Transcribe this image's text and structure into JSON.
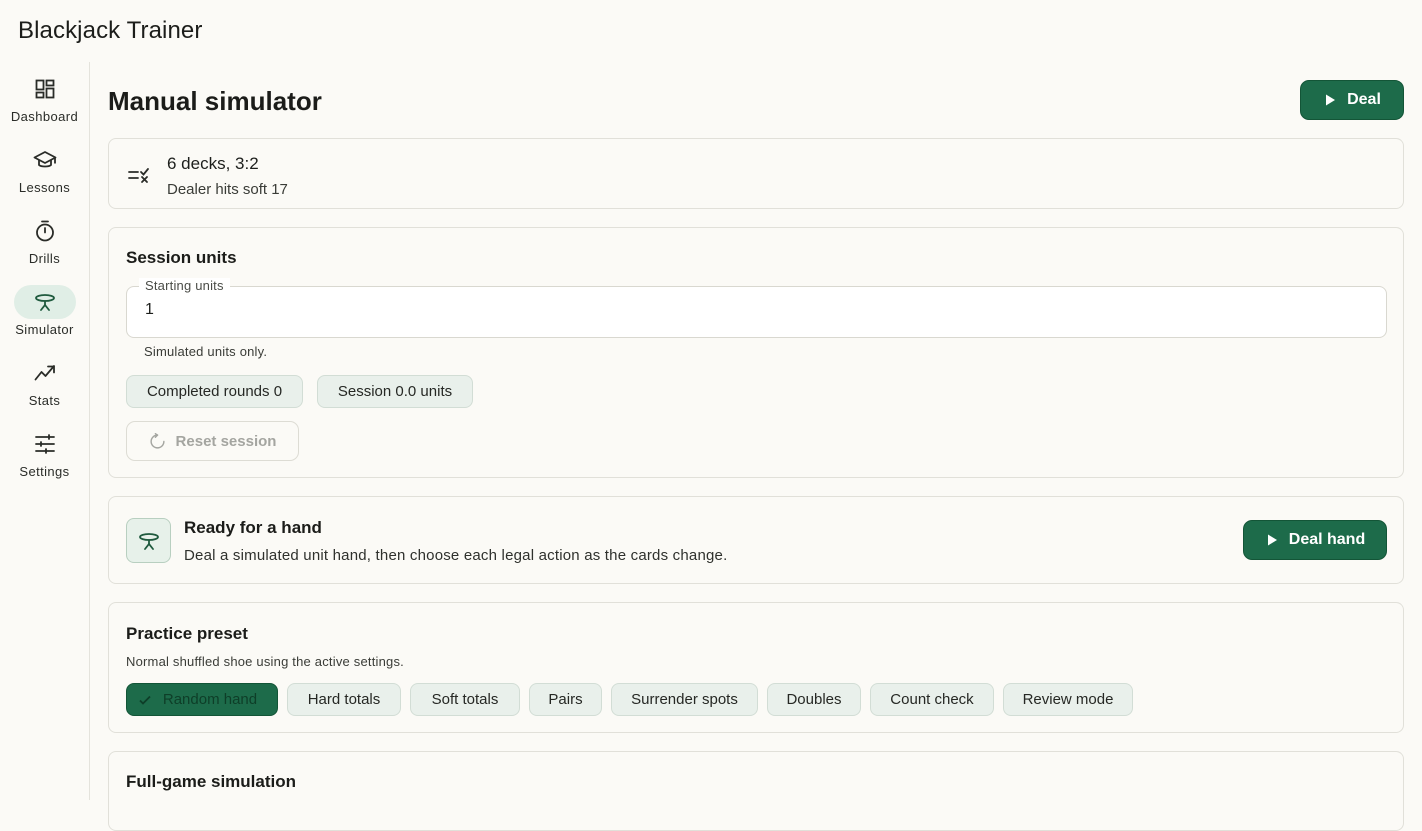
{
  "app": {
    "title": "Blackjack Trainer"
  },
  "nav": {
    "items": [
      {
        "label": "Dashboard",
        "icon": "dashboard-icon"
      },
      {
        "label": "Lessons",
        "icon": "graduation-cap-icon"
      },
      {
        "label": "Drills",
        "icon": "stopwatch-icon"
      },
      {
        "label": "Simulator",
        "icon": "table-icon",
        "active": true
      },
      {
        "label": "Stats",
        "icon": "trend-chart-icon"
      },
      {
        "label": "Settings",
        "icon": "sliders-icon"
      }
    ]
  },
  "page": {
    "title": "Manual simulator",
    "deal_label": "Deal"
  },
  "rules": {
    "main": "6 decks, 3:2",
    "sub": "Dealer hits soft 17"
  },
  "session": {
    "title": "Session units",
    "field_label": "Starting units",
    "field_value": "1",
    "helper": "Simulated units only.",
    "completed_rounds": "Completed rounds 0",
    "session_units": "Session 0.0 units",
    "reset_label": "Reset session"
  },
  "ready": {
    "title": "Ready for a hand",
    "subtitle": "Deal a simulated unit hand, then choose each legal action as the cards change.",
    "deal_hand_label": "Deal hand"
  },
  "preset": {
    "title": "Practice preset",
    "subtitle": "Normal shuffled shoe using the active settings.",
    "options": [
      "Random hand",
      "Hard totals",
      "Soft totals",
      "Pairs",
      "Surrender spots",
      "Doubles",
      "Count check",
      "Review mode"
    ],
    "selected": "Random hand"
  },
  "full_game": {
    "title": "Full-game simulation"
  },
  "colors": {
    "accent": "#1d6b4a",
    "chip_bg": "#e9f0eb",
    "active_nav": "#e0eee6"
  }
}
